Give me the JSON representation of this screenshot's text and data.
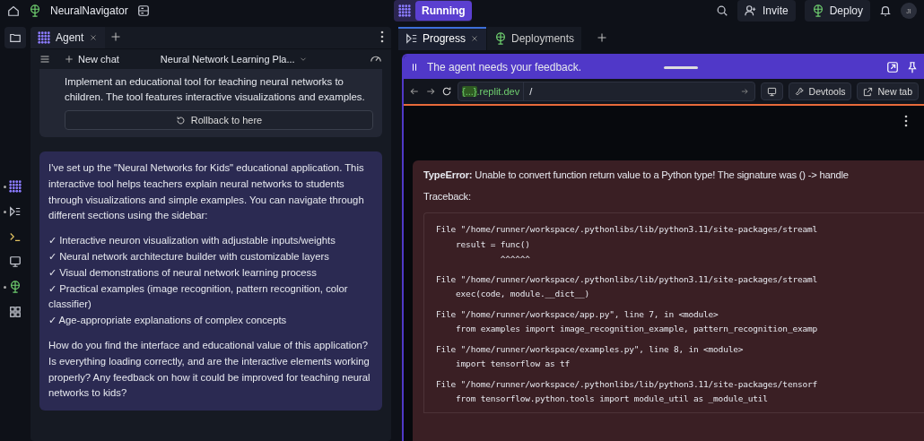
{
  "topbar": {
    "project": "NeuralNavigator",
    "status": "Running",
    "actions": [
      {
        "label": "Invite",
        "kind": "invite"
      },
      {
        "label": "Deploy",
        "kind": "deploy"
      }
    ],
    "avatar": "JI"
  },
  "rail": [
    {
      "kind": "agent",
      "dot": true
    },
    {
      "kind": "progress",
      "dot": true
    },
    {
      "kind": "shell",
      "dot": false
    },
    {
      "kind": "preview",
      "dot": false
    },
    {
      "kind": "deploy",
      "dot": true
    },
    {
      "kind": "apps",
      "dot": false
    }
  ],
  "agent_pane": {
    "tab": "Agent",
    "new_chat": "New chat",
    "chat_title": "Neural Network Learning Pla...",
    "checkpoint": {
      "text": "Implement an educational tool for teaching neural networks to children. The tool features interactive visualizations and examples.",
      "button": "Rollback to here"
    },
    "message": {
      "intro": "I've set up the \"Neural Networks for Kids\" educational application. This interactive tool helps teachers explain neural networks to students through visualizations and simple examples. You can navigate through different sections using the sidebar:",
      "items": [
        "✓ Interactive neuron visualization with adjustable inputs/weights",
        "✓ Neural network architecture builder with customizable layers",
        "✓ Visual demonstrations of neural network learning process",
        "✓ Practical examples (image recognition, pattern recognition, color classifier)",
        "✓ Age-appropriate explanations of complex concepts"
      ],
      "question": "How do you find the interface and educational value of this application? Is everything loading correctly, and are the interactive elements working properly? Any feedback on how it could be improved for teaching neural networks to kids?"
    }
  },
  "right_tabs": [
    {
      "label": "Progress",
      "kind": "progress",
      "selected": true
    },
    {
      "label": "Deployments",
      "kind": "deploy",
      "selected": false
    }
  ],
  "banner": "The agent needs your feedback.",
  "browser": {
    "domain_prefix": "{...}",
    "domain": ".replit.dev",
    "path": "/",
    "buttons": [
      {
        "label": "Devtools",
        "kind": "devtools"
      },
      {
        "label": "New tab",
        "kind": "newtab"
      }
    ]
  },
  "error": {
    "type": "TypeError:",
    "message": " Unable to convert function return value to a Python type! The signature was () -> handle",
    "traceback_label": "Traceback:",
    "frames": [
      {
        "file": "File \"/home/runner/workspace/.pythonlibs/lib/python3.11/site-packages/streaml",
        "lines": [
          "    result = func()",
          "             ^^^^^^"
        ]
      },
      {
        "file": "File \"/home/runner/workspace/.pythonlibs/lib/python3.11/site-packages/streaml",
        "lines": [
          "    exec(code, module.__dict__)"
        ]
      },
      {
        "file": "File \"/home/runner/workspace/app.py\", line 7, in <module>",
        "lines": [
          "    from examples import image_recognition_example, pattern_recognition_examp"
        ]
      },
      {
        "file": "File \"/home/runner/workspace/examples.py\", line 8, in <module>",
        "lines": [
          "    import tensorflow as tf"
        ]
      },
      {
        "file": "File \"/home/runner/workspace/.pythonlibs/lib/python3.11/site-packages/tensorf",
        "lines": [
          "    from tensorflow.python.tools import module_util as _module_util"
        ]
      }
    ]
  }
}
